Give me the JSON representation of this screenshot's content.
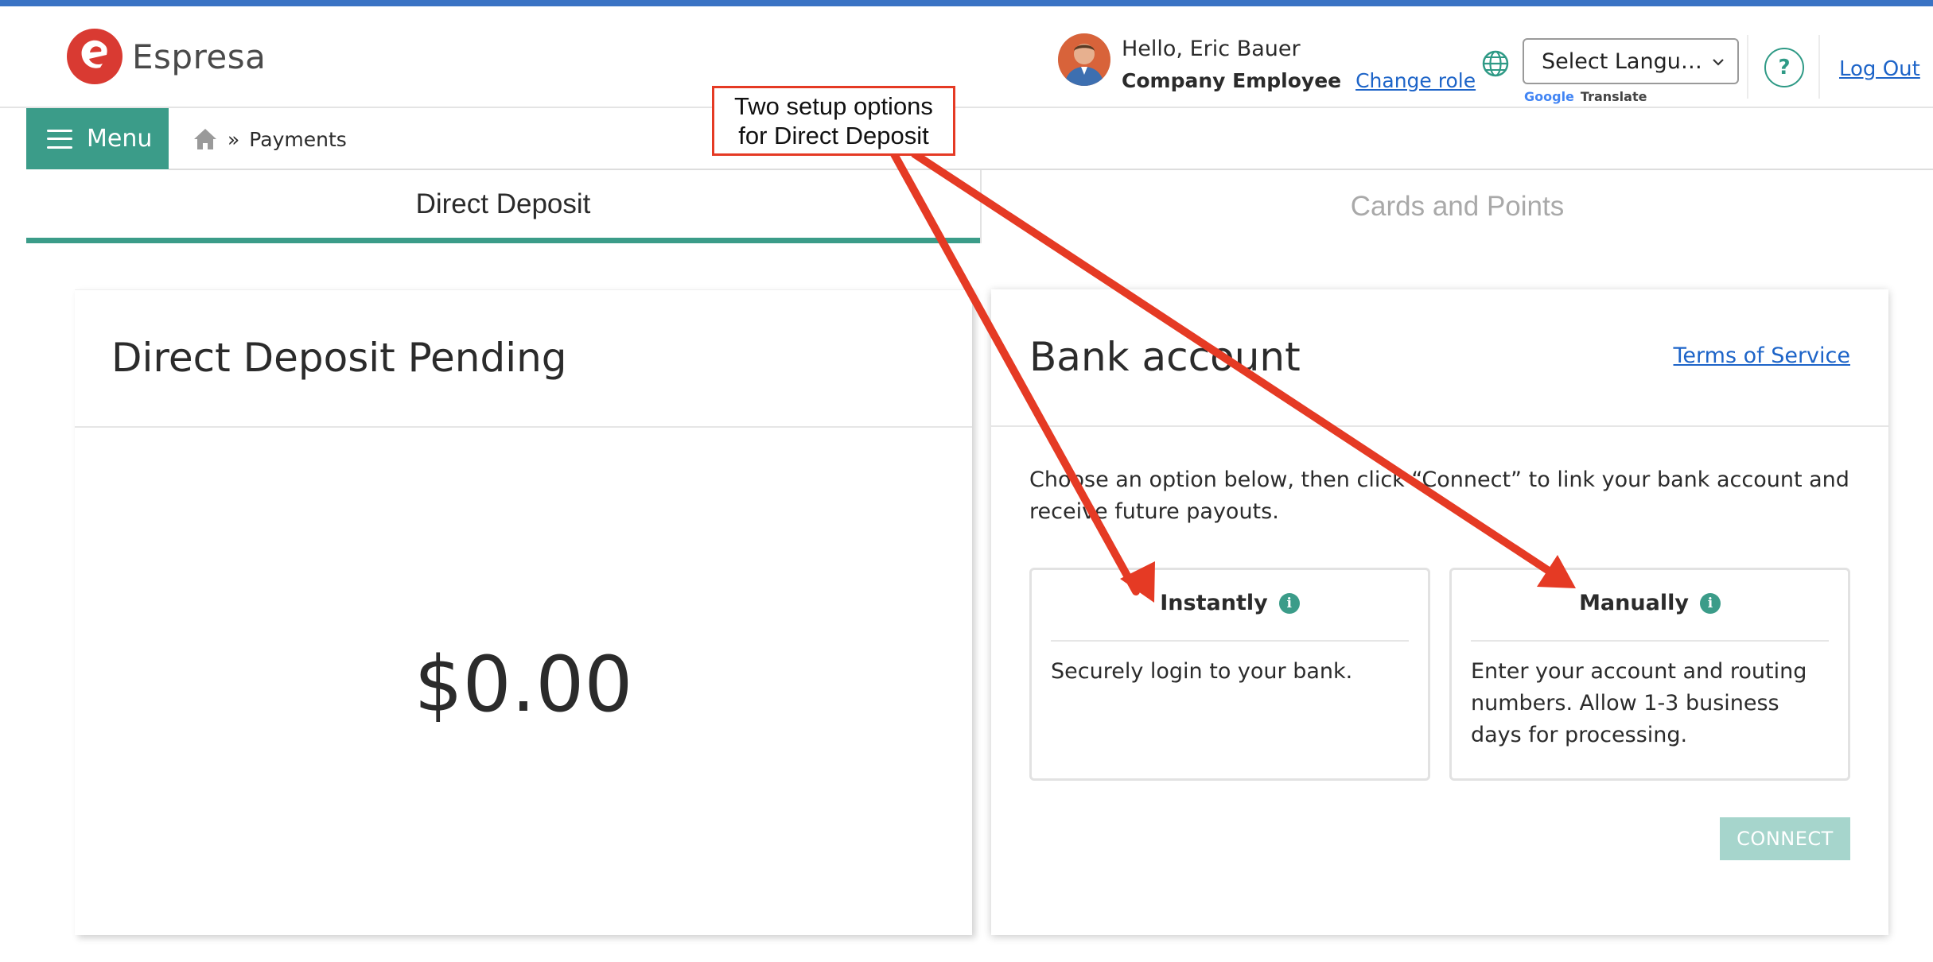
{
  "app": {
    "brand": "Espresa"
  },
  "header": {
    "greeting": "Hello, Eric Bauer",
    "role": "Company Employee",
    "change_role": "Change role",
    "language_select": "Select Langu…",
    "google_word": "Google",
    "translate_word": "Translate",
    "help_label": "?",
    "logout": "Log Out"
  },
  "nav": {
    "menu_label": "Menu",
    "breadcrumb_sep": "»",
    "breadcrumb_current": "Payments"
  },
  "tabs": [
    {
      "label": "Direct Deposit",
      "active": true
    },
    {
      "label": "Cards and Points",
      "active": false
    }
  ],
  "pending_card": {
    "title": "Direct Deposit Pending",
    "amount": "$0.00"
  },
  "bank_card": {
    "title": "Bank account",
    "terms_link": "Terms of Service",
    "intro": "Choose an option below, then click “Connect” to link your bank account and receive future payouts.",
    "options": [
      {
        "title": "Instantly",
        "info": "i",
        "description": "Securely login to your bank."
      },
      {
        "title": "Manually",
        "info": "i",
        "description": "Enter your account and routing numbers. Allow 1-3 business days for processing."
      }
    ],
    "connect_label": "CONNECT"
  },
  "annotation": {
    "line1": "Two setup options",
    "line2": "for Direct Deposit"
  },
  "colors": {
    "accent": "#3b9c89",
    "link": "#1d64c8",
    "annotation": "#e53a24",
    "brand": "#d93a32"
  }
}
